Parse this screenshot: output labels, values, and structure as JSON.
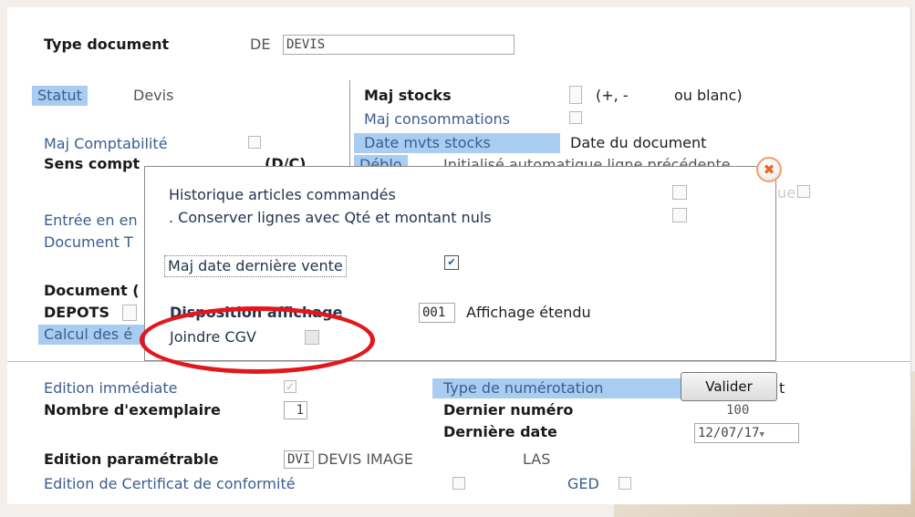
{
  "header": {
    "type_document_label": "Type document",
    "type_document_code": "DE",
    "type_document_value": "DEVIS"
  },
  "left": {
    "statut_label": "Statut",
    "statut_value": "Devis",
    "maj_compta_label": "Maj Comptabilité",
    "sens_compta_label": "Sens compt",
    "sens_compta_value": "(D/C)",
    "entree_label": "Entrée en en",
    "document_t_label": "Document T",
    "document_g_label": "Document (",
    "depots_label": "DEPOTS",
    "calcul_label": "Calcul des é"
  },
  "right": {
    "maj_stocks_label": "Maj stocks",
    "maj_stocks_hint_a": "(+, -",
    "maj_stocks_hint_b": "ou blanc)",
    "maj_conso_label": "Maj consommations",
    "date_mvts_label": "Date mvts stocks",
    "date_mvts_value": "Date du document",
    "deblocage_label": "Déblo",
    "deblocage_value": "Initialisé automatique ligne précédente",
    "historique_label": "Historique"
  },
  "dialog": {
    "line1": "Historique articles commandés",
    "line2": ". Conserver lignes avec Qté et montant nuls",
    "maj_date_label": "Maj date dernière vente",
    "maj_date_checked": "✔",
    "disposition_label": "Disposition affichage",
    "disposition_code": "001",
    "disposition_value": "Affichage étendu",
    "joindre_cgv_label": "Joindre CGV",
    "close_glyph": "✖"
  },
  "bottom": {
    "edition_immediate_label": "Edition immédiate",
    "edition_immediate_checked": "✓",
    "nb_exemplaire_label": "Nombre d'exemplaire",
    "nb_exemplaire_value": "1",
    "type_numerotation_label": "Type de numérotation",
    "type_numerotation_tail": "t",
    "dernier_numero_label": "Dernier numéro",
    "dernier_numero_value": "100",
    "derniere_date_label": "Dernière date",
    "derniere_date_value": "12/07/17",
    "edition_param_label": "Edition paramétrable",
    "edition_param_code": "DVI",
    "edition_param_value": "DEVIS IMAGE",
    "edition_param_las": "LAS",
    "certificat_label": "Edition de Certificat de conformité",
    "ged_label": "GED"
  },
  "actions": {
    "valider_label": "Valider"
  },
  "colors": {
    "highlight": "#a9cdf0",
    "label_blue": "#3a5d8f",
    "annotation_red": "#e3161c",
    "close_orange": "#e8651c"
  }
}
